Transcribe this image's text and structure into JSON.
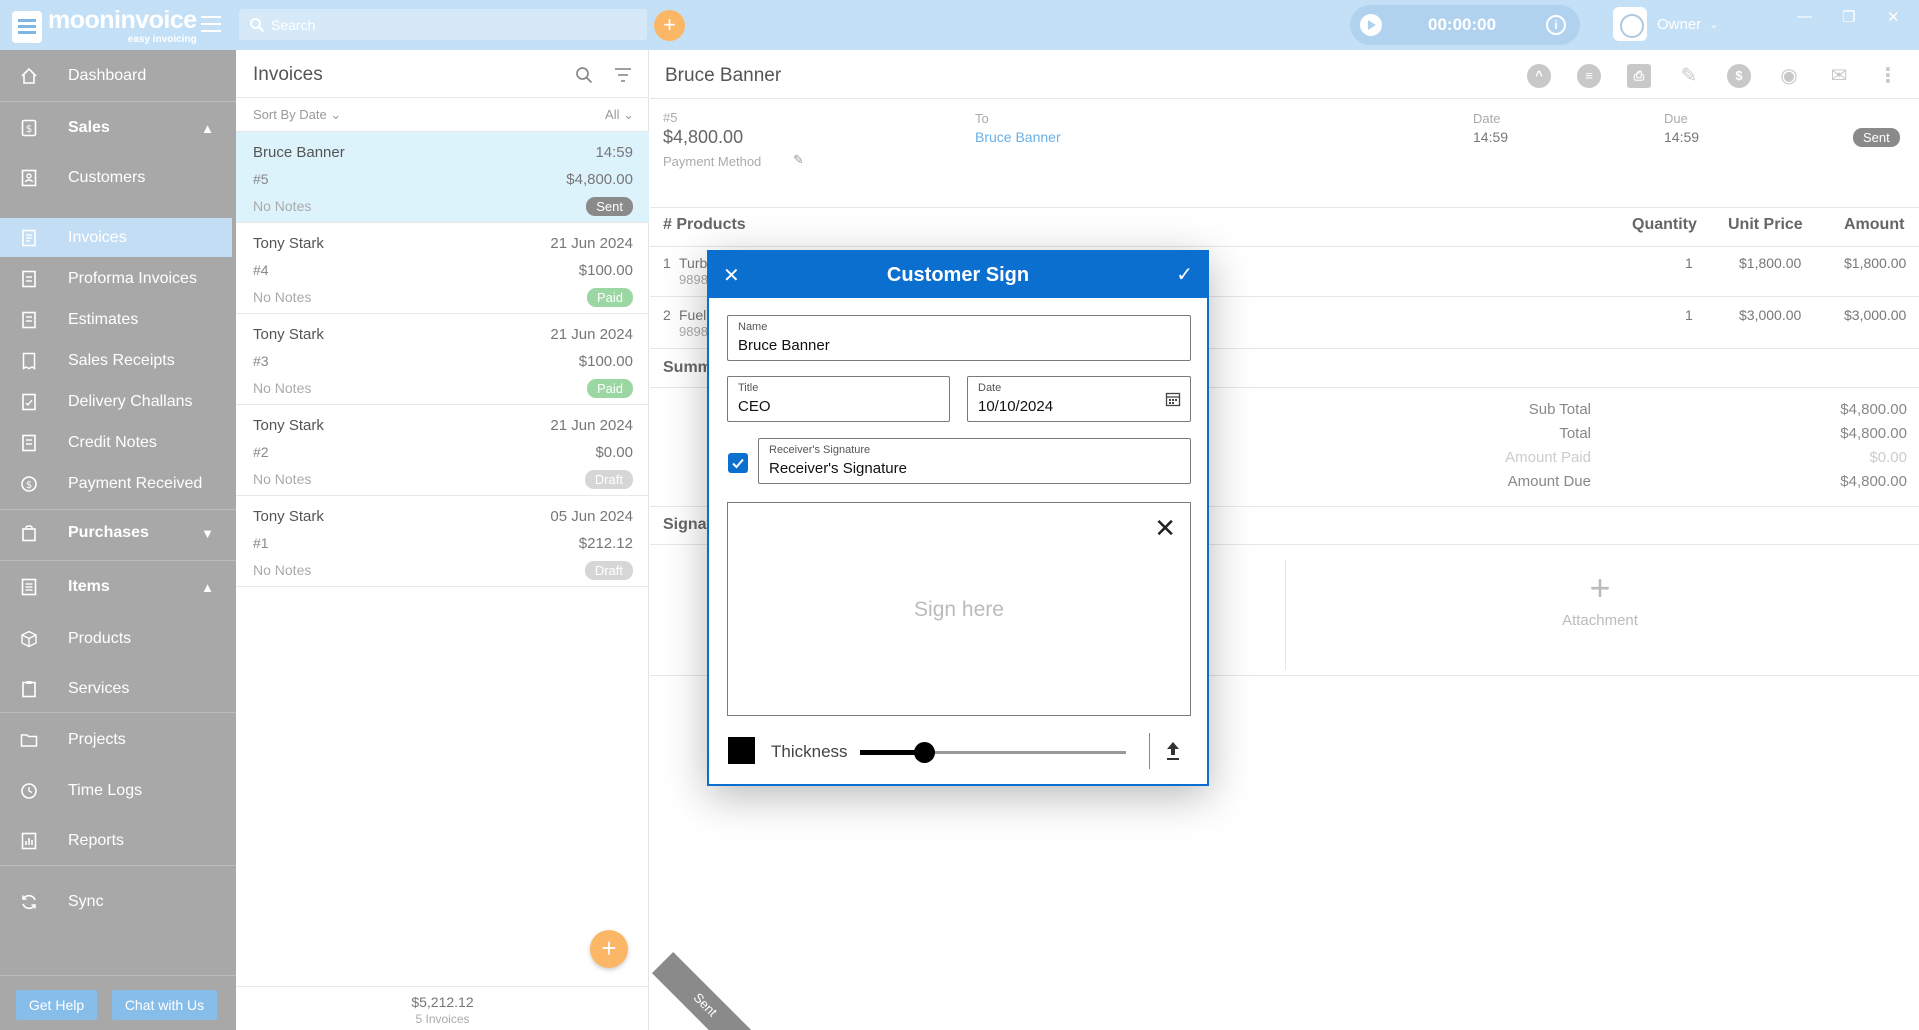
{
  "app": {
    "logo_name": "mooninvoice",
    "logo_tagline": "easy invoicing",
    "search_placeholder": "Search",
    "timer": "00:00:00",
    "user": "Owner",
    "window_controls": [
      "—",
      "❐",
      "✕"
    ]
  },
  "sidebar": {
    "items": [
      {
        "label": "Dashboard",
        "icon": "home-icon"
      },
      {
        "label": "Sales",
        "icon": "dollar-doc-icon",
        "group": true,
        "expanded": true
      },
      {
        "label": "Customers",
        "icon": "contacts-icon"
      },
      {
        "label": "Invoices",
        "icon": "invoice-icon",
        "selected": true
      },
      {
        "label": "Proforma Invoices",
        "icon": "doc-icon"
      },
      {
        "label": "Estimates",
        "icon": "estimate-icon"
      },
      {
        "label": "Sales Receipts",
        "icon": "receipt-icon"
      },
      {
        "label": "Delivery Challans",
        "icon": "delivery-icon"
      },
      {
        "label": "Credit Notes",
        "icon": "credit-icon"
      },
      {
        "label": "Payment Received",
        "icon": "payment-icon"
      },
      {
        "label": "Purchases",
        "icon": "bag-icon",
        "group": true,
        "expanded": false
      },
      {
        "label": "Items",
        "icon": "list-icon",
        "group": true,
        "expanded": true
      },
      {
        "label": "Products",
        "icon": "box-icon"
      },
      {
        "label": "Services",
        "icon": "clipboard-icon"
      },
      {
        "label": "Projects",
        "icon": "folder-icon"
      },
      {
        "label": "Time Logs",
        "icon": "clock-icon"
      },
      {
        "label": "Reports",
        "icon": "chart-icon"
      },
      {
        "label": "Sync",
        "icon": "sync-icon"
      }
    ],
    "help_button": "Get Help",
    "chat_button": "Chat with Us"
  },
  "list": {
    "title": "Invoices",
    "sort_label": "Sort By Date",
    "filter_label": "All",
    "invoices": [
      {
        "name": "Bruce Banner",
        "date": "14:59",
        "number": "#5",
        "amount": "$4,800.00",
        "notes": "No Notes",
        "status": "Sent",
        "status_color": "#8a8a8a"
      },
      {
        "name": "Tony Stark",
        "date": "21 Jun 2024",
        "number": "#4",
        "amount": "$100.00",
        "notes": "No Notes",
        "status": "Paid",
        "status_color": "#9ad7a2"
      },
      {
        "name": "Tony Stark",
        "date": "21 Jun 2024",
        "number": "#3",
        "amount": "$100.00",
        "notes": "No Notes",
        "status": "Paid",
        "status_color": "#9ad7a2"
      },
      {
        "name": "Tony Stark",
        "date": "21 Jun 2024",
        "number": "#2",
        "amount": "$0.00",
        "notes": "No Notes",
        "status": "Draft",
        "status_color": "#d6d6d6"
      },
      {
        "name": "Tony Stark",
        "date": "05 Jun 2024",
        "number": "#1",
        "amount": "$212.12",
        "notes": "No Notes",
        "status": "Draft",
        "status_color": "#d6d6d6"
      }
    ],
    "total": "$5,212.12",
    "count": "5 Invoices"
  },
  "detail": {
    "customer": "Bruce Banner",
    "number": "#5",
    "amount": "$4,800.00",
    "payment_method_label": "Payment Method",
    "to_label": "To",
    "to_value": "Bruce Banner",
    "date_label": "Date",
    "date_value": "14:59",
    "due_label": "Due",
    "due_value": "14:59",
    "status": "Sent",
    "products_header": "# Products",
    "qty_header": "Quantity",
    "unit_header": "Unit Price",
    "amount_header": "Amount",
    "products": [
      {
        "index": "1",
        "name": "Turb",
        "code": "9898",
        "qty": "1",
        "unit": "$1,800.00",
        "amount": "$1,800.00"
      },
      {
        "index": "2",
        "name": "Fuel",
        "code": "9898",
        "qty": "1",
        "unit": "$3,000.00",
        "amount": "$3,000.00"
      }
    ],
    "summary_header": "Summ",
    "summary": [
      {
        "label": "Sub Total",
        "value": "$4,800.00"
      },
      {
        "label": "Total",
        "value": "$4,800.00"
      },
      {
        "label": "Amount Paid",
        "value": "$0.00"
      },
      {
        "label": "Amount Due",
        "value": "$4,800.00"
      }
    ],
    "signature_header": "Signat",
    "attachment_label": "Attachment",
    "ribbon": "Sent"
  },
  "dialog": {
    "title": "Customer Sign",
    "name_label": "Name",
    "name_value": "Bruce Banner",
    "title_label": "Title",
    "title_value": "CEO",
    "date_label": "Date",
    "date_value": "10/10/2024",
    "receiver_checked": true,
    "receiver_label": "Receiver's Signature",
    "receiver_value": "Receiver's Signature",
    "sign_hint": "Sign here",
    "thickness_label": "Thickness",
    "thickness_level": 0.24,
    "pen_color": "#000000"
  }
}
